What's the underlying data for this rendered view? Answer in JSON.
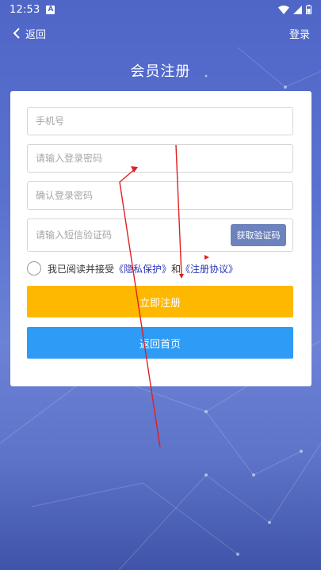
{
  "status_bar": {
    "time": "12:53",
    "notification_icon_letter": "A",
    "icons": [
      "wifi-icon",
      "signal-icon",
      "battery-icon"
    ]
  },
  "nav": {
    "back_label": "返回",
    "login_label": "登录"
  },
  "page": {
    "title": "会员注册"
  },
  "form": {
    "phone_placeholder": "手机号",
    "password_placeholder": "请输入登录密码",
    "confirm_placeholder": "确认登录密码",
    "sms_placeholder": "请输入短信验证码",
    "sms_button": "获取验证码",
    "agree_text": "我已阅读并接受",
    "privacy_link": "《隐私保护》",
    "and_text": "和",
    "agreement_link": "《注册协议》",
    "register_button": "立即注册",
    "home_button": "返回首页"
  },
  "colors": {
    "background": "#5a72cf",
    "register_button": "#ffb800",
    "home_button": "#2e9bf6",
    "sms_button": "#6e83bd",
    "link": "#2a36b8",
    "annotation": "#e02020"
  }
}
